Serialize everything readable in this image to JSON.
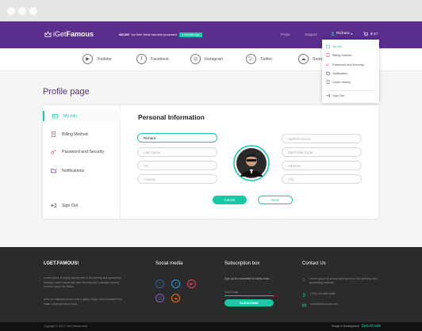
{
  "header": {
    "logo_light": "iGet",
    "logo_bold": "Famous",
    "announce_count": "500,000",
    "announce_text": "YouTube Views has been purchased",
    "announce_badge": "4 minutes ago",
    "nav": [
      "FAQs",
      "Support"
    ],
    "user_name": "Richard",
    "cart_amount": "$ 47"
  },
  "social_tabs": [
    "Youtube",
    "Facebook",
    "Instagram",
    "Twitter",
    "Sound"
  ],
  "dropdown": {
    "items": [
      "My info",
      "Billing Method",
      "Password and Security",
      "Notification",
      "Order History"
    ],
    "sign_out": "Sign Out"
  },
  "page": {
    "title": "Profile page",
    "section_title": "Personal Information"
  },
  "sidebar": {
    "items": [
      "My Info",
      "Billing Method",
      "Password and Security",
      "Notifications"
    ],
    "sign_out": "Sign Out"
  },
  "form": {
    "first_name_value": "Richard",
    "last_name_placeholder": "Last Name",
    "tel_placeholder": "Tel",
    "country_placeholder": "Country",
    "state_placeholder": "State/Province",
    "zip_placeholder": "Zip/Postal Code",
    "address_placeholder": "Address",
    "city_placeholder": "City",
    "cancel_label": "Cancel",
    "save_label": "Save"
  },
  "footer": {
    "brand": "I.GET.FAMOUS!",
    "brand_text_1": "Lorem Ipsum is simply dummy text of the printing and typesetting industry. Lorem Ipsum has been the industry's standard dummy text ever since the 1500s,",
    "brand_text_2": "when an unknown printer took a galley of type and scrambled it to make a type specimen book.",
    "social_title": "Social media",
    "subscription_title": "Subscription box",
    "subscription_text": "Sign up the newsletter for latest news",
    "email_placeholder": "Your Email",
    "subscribe_label": "SUBSCRIBE",
    "contact_title": "Contact Us",
    "contact_address": "Lorem Ipsum is simply dummy text of the printing and typesetting industry",
    "contact_phone": "(+91) 000 888 8888",
    "contact_email": "hello@deluxcode.com",
    "copyright": "Copyright © 2017 I Get Famous.com",
    "dev_text": "Design & Development",
    "dev_brand": "DeluXcode"
  },
  "colors": {
    "brand_purple": "#5b2d8c",
    "accent_teal": "#18c9a6",
    "footer_dark": "#2b2b2b"
  }
}
